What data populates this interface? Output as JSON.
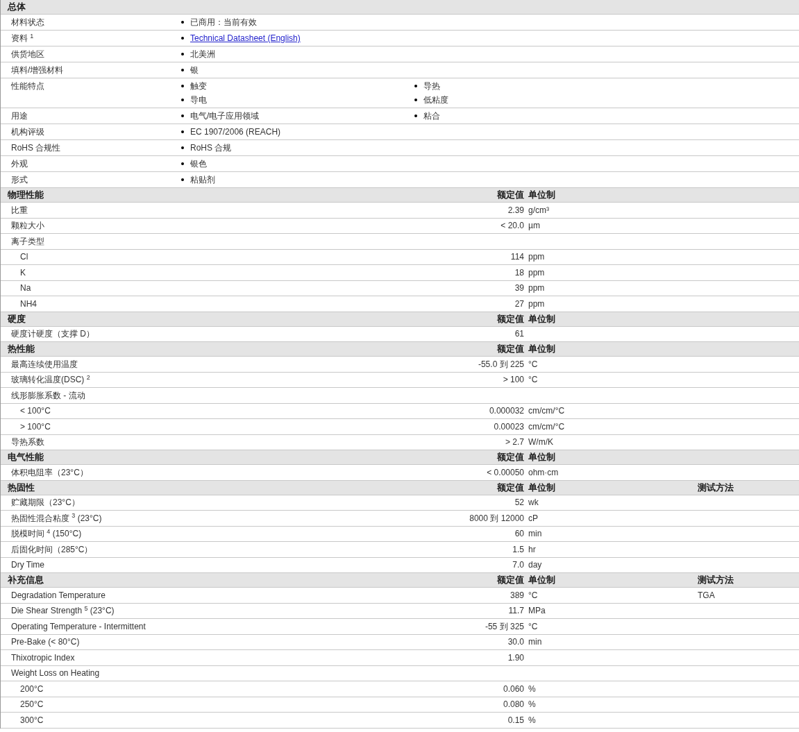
{
  "sections": [
    {
      "title": "总体",
      "kind": "general",
      "rows": [
        {
          "label": "材料状态",
          "columns": [
            [
              {
                "text": "已商用：当前有效",
                "kind": "text"
              }
            ]
          ]
        },
        {
          "label": "资料 $^{1}$",
          "columns": [
            [
              {
                "text": "Technical Datasheet (English)",
                "kind": "link"
              }
            ]
          ]
        },
        {
          "label": "供货地区",
          "columns": [
            [
              {
                "text": "北美洲",
                "kind": "text"
              }
            ]
          ]
        },
        {
          "label": "填料/增强材料",
          "columns": [
            [
              {
                "text": "银",
                "kind": "text"
              }
            ]
          ]
        },
        {
          "label": "性能特点",
          "columns": [
            [
              {
                "text": "触变",
                "kind": "text"
              },
              {
                "text": "导电",
                "kind": "text"
              }
            ],
            [
              {
                "text": "导热",
                "kind": "text"
              },
              {
                "text": "低粘度",
                "kind": "text"
              }
            ]
          ]
        },
        {
          "label": "用途",
          "columns": [
            [
              {
                "text": "电气/电子应用领域",
                "kind": "text"
              }
            ],
            [
              {
                "text": "粘合",
                "kind": "text"
              }
            ]
          ]
        },
        {
          "label": "机构评级",
          "columns": [
            [
              {
                "text": "EC 1907/2006 (REACH)",
                "kind": "text"
              }
            ]
          ]
        },
        {
          "label": "RoHS 合规性",
          "columns": [
            [
              {
                "text": "RoHS 合规",
                "kind": "text"
              }
            ]
          ]
        },
        {
          "label": "外观",
          "columns": [
            [
              {
                "text": "银色",
                "kind": "text"
              }
            ]
          ]
        },
        {
          "label": "形式",
          "columns": [
            [
              {
                "text": "粘贴剂",
                "kind": "text"
              }
            ]
          ]
        }
      ]
    },
    {
      "title": "物理性能",
      "kind": "properties",
      "headers": [
        "额定值",
        "单位制"
      ],
      "rows": [
        {
          "label": "比重",
          "value": "2.39",
          "unit": "g/cm³"
        },
        {
          "label": "颗粒大小",
          "value": "< 20.0",
          "unit": "µm"
        },
        {
          "label": "离子类型",
          "children": [
            {
              "label": "Cl",
              "value": "114",
              "unit": "ppm"
            },
            {
              "label": "K",
              "value": "18",
              "unit": "ppm"
            },
            {
              "label": "Na",
              "value": "39",
              "unit": "ppm"
            },
            {
              "label": "NH4",
              "value": "27",
              "unit": "ppm"
            }
          ]
        }
      ]
    },
    {
      "title": "硬度",
      "kind": "properties",
      "headers": [
        "额定值",
        "单位制"
      ],
      "rows": [
        {
          "label": "硬度计硬度（支撑 D）",
          "value": "61"
        }
      ]
    },
    {
      "title": "热性能",
      "kind": "properties",
      "headers": [
        "额定值",
        "单位制"
      ],
      "rows": [
        {
          "label": "最高连续使用温度",
          "value": "-55.0 到 225",
          "unit": "°C"
        },
        {
          "label": "玻璃转化温度(DSC) $^{2}$",
          "value": "> 100",
          "unit": "°C"
        },
        {
          "label": "线形膨胀系数 - 流动",
          "children": [
            {
              "label": "< 100°C",
              "value": "0.000032",
              "unit": "cm/cm/°C"
            },
            {
              "label": "> 100°C",
              "value": "0.00023",
              "unit": "cm/cm/°C"
            }
          ]
        },
        {
          "label": "导热系数",
          "value": "> 2.7",
          "unit": "W/m/K"
        }
      ]
    },
    {
      "title": "电气性能",
      "kind": "properties",
      "headers": [
        "额定值",
        "单位制"
      ],
      "rows": [
        {
          "label": "体积电阻率（23°C）",
          "value": "< 0.00050",
          "unit": "ohm·cm"
        }
      ]
    },
    {
      "title": "热固性",
      "kind": "properties",
      "headers": [
        "额定值",
        "单位制",
        "测试方法"
      ],
      "rows": [
        {
          "label": "贮藏期限（23°C）",
          "value": "52",
          "unit": "wk"
        },
        {
          "label": "热固性混合粘度 $^{3}$ (23°C)",
          "value": "8000 到 12000",
          "unit": "cP"
        },
        {
          "label": "脱模时间 $^{4}$ (150°C)",
          "value": "60",
          "unit": "min"
        },
        {
          "label": "后固化时间（285°C）",
          "value": "1.5",
          "unit": "hr"
        },
        {
          "label": "Dry Time",
          "value": "7.0",
          "unit": "day"
        }
      ]
    },
    {
      "title": "补充信息",
      "kind": "properties",
      "headers": [
        "额定值",
        "单位制",
        "测试方法"
      ],
      "rows": [
        {
          "label": "Degradation Temperature",
          "value": "389",
          "unit": "°C",
          "method": "TGA"
        },
        {
          "label": "Die Shear Strength $^{5}$ (23°C)",
          "value": "11.7",
          "unit": "MPa"
        },
        {
          "label": "Operating Temperature - Intermittent",
          "value": "-55 到 325",
          "unit": "°C"
        },
        {
          "label": "Pre-Bake (< 80°C)",
          "value": "30.0",
          "unit": "min"
        },
        {
          "label": "Thixotropic Index",
          "value": "1.90"
        },
        {
          "label": "Weight Loss on Heating",
          "children": [
            {
              "label": "200°C",
              "value": "0.060",
              "unit": "%"
            },
            {
              "label": "250°C",
              "value": "0.080",
              "unit": "%"
            },
            {
              "label": "300°C",
              "value": "0.15",
              "unit": "%"
            }
          ]
        }
      ]
    }
  ]
}
